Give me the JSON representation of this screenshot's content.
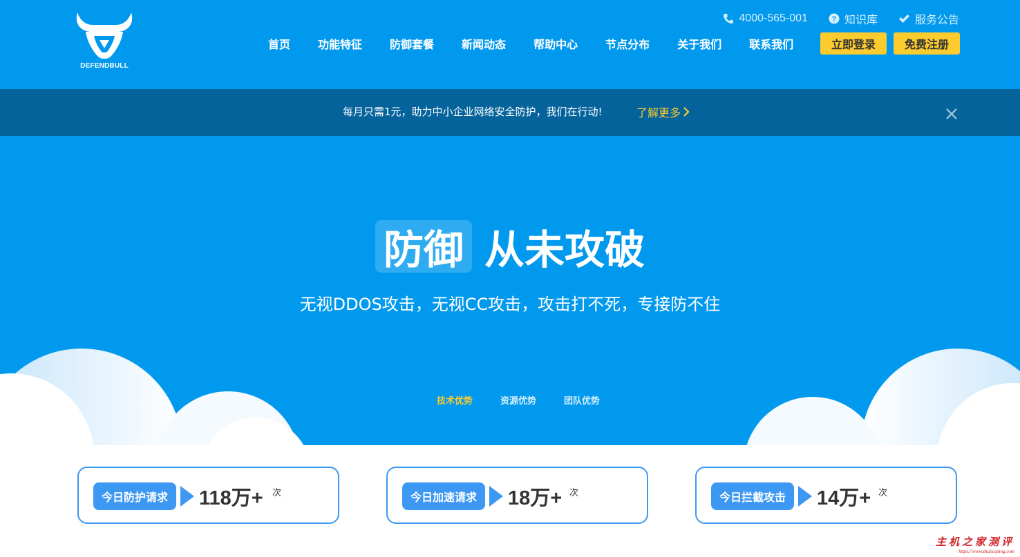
{
  "brand": {
    "logo_text": "DEFENDBULL"
  },
  "topbar": {
    "phone": "4000-565-001",
    "phone_icon": "phone-icon",
    "knowledge": "知识库",
    "knowledge_icon": "question-circle-icon",
    "notice": "服务公告",
    "notice_icon": "check-icon"
  },
  "nav": {
    "items": [
      {
        "label": "首页"
      },
      {
        "label": "功能特征"
      },
      {
        "label": "防御套餐"
      },
      {
        "label": "新闻动态"
      },
      {
        "label": "帮助中心"
      },
      {
        "label": "节点分布"
      },
      {
        "label": "关于我们"
      },
      {
        "label": "联系我们"
      }
    ],
    "login_label": "立即登录",
    "register_label": "免费注册"
  },
  "announcement": {
    "text": "每月只需1元，助力中小企业网络安全防护，我们在行动!",
    "link_label": "了解更多",
    "link_icon": "chevron-right-icon",
    "close_icon": "close-icon"
  },
  "hero": {
    "title_highlight": "防御",
    "title_main": "从未攻破",
    "subtitle": "无视DDOS攻击，无视CC攻击，攻击打不死，专接防不住",
    "tabs": [
      {
        "label": "技术优势",
        "active": true
      },
      {
        "label": "资源优势",
        "active": false
      },
      {
        "label": "团队优势",
        "active": false
      }
    ]
  },
  "stats": [
    {
      "label": "今日防护请求",
      "value": "118万+",
      "unit": "次"
    },
    {
      "label": "今日加速请求",
      "value": "18万+",
      "unit": "次"
    },
    {
      "label": "今日拦截攻击",
      "value": "14万+",
      "unit": "次"
    }
  ],
  "watermark": {
    "text": "主机之家测评",
    "url": "https://www.zhujiceping.com"
  },
  "colors": {
    "primary_blue": "#0199ee",
    "announce_bg": "#05639c",
    "accent_yellow": "#fccb2d",
    "stat_blue": "#3c98f2"
  }
}
